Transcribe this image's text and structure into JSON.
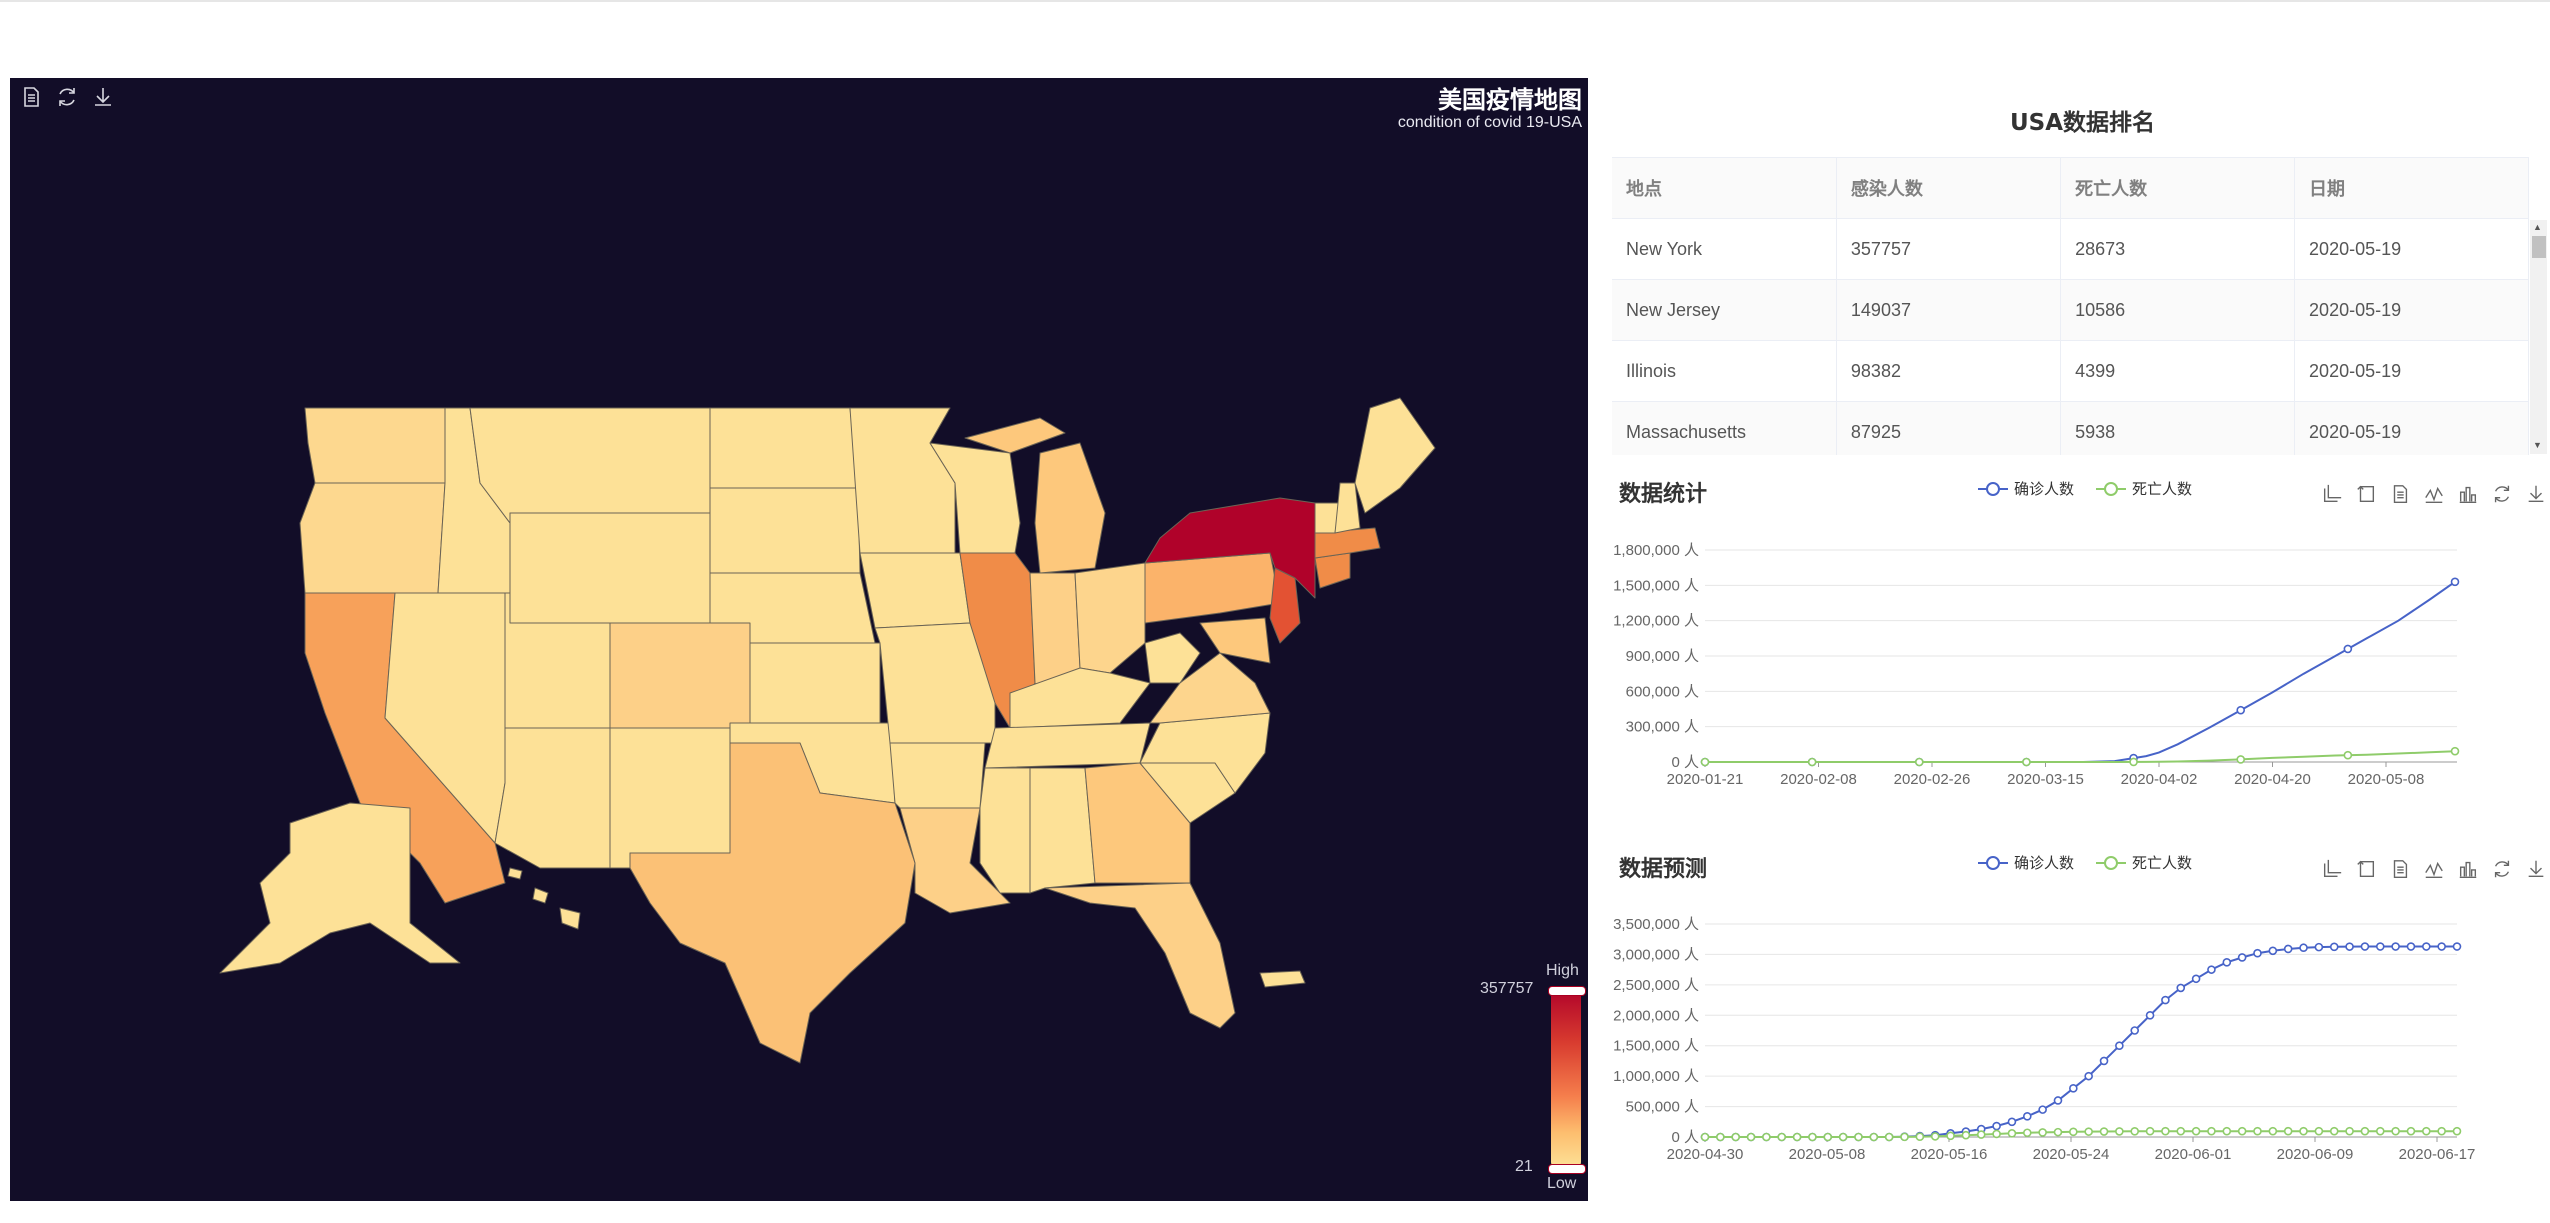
{
  "map": {
    "title": "美国疫情地图",
    "subtitle": "condition of covid 19-USA",
    "visual_map": {
      "high_label": "High",
      "low_label": "Low",
      "max": "357757",
      "min": "21"
    },
    "tools": [
      "text-icon",
      "refresh-icon",
      "download-icon"
    ]
  },
  "ranking": {
    "title": "USA数据排名",
    "columns": [
      "地点",
      "感染人数",
      "死亡人数",
      "日期"
    ],
    "rows": [
      [
        "New York",
        "357757",
        "28673",
        "2020-05-19"
      ],
      [
        "New Jersey",
        "149037",
        "10586",
        "2020-05-19"
      ],
      [
        "Illinois",
        "98382",
        "4399",
        "2020-05-19"
      ],
      [
        "Massachusetts",
        "87925",
        "5938",
        "2020-05-19"
      ]
    ]
  },
  "stats": {
    "title": "数据统计",
    "legend": [
      "确诊人数",
      "死亡人数"
    ]
  },
  "forecast": {
    "title": "数据预测",
    "legend": [
      "确诊人数",
      "死亡人数"
    ]
  },
  "colors": {
    "confirmed": "#4763c8",
    "deaths": "#8fcc6a",
    "map_bg": "#120d28",
    "map_high": "#b0022a",
    "map_low": "#fde197"
  },
  "chart_data": [
    {
      "type": "line",
      "title": "数据统计",
      "categories": [
        "2020-01-21",
        "2020-02-08",
        "2020-02-26",
        "2020-03-15",
        "2020-04-02",
        "2020-04-20",
        "2020-05-08"
      ],
      "ytick_labels": [
        "0 人",
        "300,000 人",
        "600,000 人",
        "900,000 人",
        "1,200,000 人",
        "1,500,000 人",
        "1,800,000 人"
      ],
      "ylim": [
        0,
        1800000
      ],
      "x": [
        0,
        5,
        10,
        15,
        18,
        20,
        25,
        30,
        35,
        40,
        45,
        50,
        55,
        60,
        65,
        70,
        72,
        75,
        80,
        85,
        90,
        95,
        100,
        105,
        110,
        115,
        119
      ],
      "series": [
        {
          "name": "确诊人数",
          "values": [
            0,
            0,
            0,
            0,
            0,
            0,
            0,
            0,
            0,
            0,
            0,
            0,
            0,
            0,
            8000,
            50000,
            80000,
            150000,
            290000,
            440000,
            590000,
            750000,
            900000,
            1050000,
            1200000,
            1380000,
            1530000
          ]
        },
        {
          "name": "死亡人数",
          "values": [
            0,
            0,
            0,
            0,
            0,
            0,
            0,
            0,
            0,
            0,
            0,
            0,
            0,
            0,
            0,
            1000,
            2000,
            4000,
            12000,
            22000,
            35000,
            45000,
            55000,
            62000,
            72000,
            82000,
            92000
          ]
        }
      ],
      "marker_every_x": 17
    },
    {
      "type": "line",
      "title": "数据预测",
      "categories": [
        "2020-04-30",
        "2020-05-08",
        "2020-05-16",
        "2020-05-24",
        "2020-06-01",
        "2020-06-09",
        "2020-06-17"
      ],
      "ytick_labels": [
        "0 人",
        "500,000 人",
        "1,000,000 人",
        "1,500,000 人",
        "2,000,000 人",
        "2,500,000 人",
        "3,000,000 人",
        "3,500,000 人"
      ],
      "ylim": [
        0,
        3500000
      ],
      "x_days": 50,
      "series": [
        {
          "name": "确诊人数",
          "values": [
            0,
            0,
            0,
            0,
            0,
            0,
            0,
            0,
            0,
            0,
            0,
            0,
            0,
            5000,
            15000,
            30000,
            60000,
            90000,
            130000,
            180000,
            250000,
            340000,
            450000,
            600000,
            800000,
            1000000,
            1250000,
            1500000,
            1750000,
            2000000,
            2250000,
            2450000,
            2600000,
            2750000,
            2870000,
            2950000,
            3020000,
            3060000,
            3090000,
            3110000,
            3120000,
            3125000,
            3128000,
            3130000,
            3130000,
            3130000,
            3130000,
            3130000,
            3130000,
            3130000
          ]
        },
        {
          "name": "死亡人数",
          "values": [
            0,
            0,
            0,
            0,
            0,
            0,
            0,
            0,
            0,
            0,
            0,
            0,
            0,
            2000,
            5000,
            10000,
            20000,
            30000,
            40000,
            50000,
            60000,
            70000,
            75000,
            80000,
            85000,
            88000,
            90000,
            92000,
            94000,
            95000,
            96000,
            96000,
            96000,
            96000,
            96000,
            96000,
            96000,
            96000,
            96000,
            96000,
            96000,
            96000,
            96000,
            96000,
            96000,
            96000,
            96000,
            96000,
            96000,
            96000
          ]
        }
      ]
    }
  ]
}
